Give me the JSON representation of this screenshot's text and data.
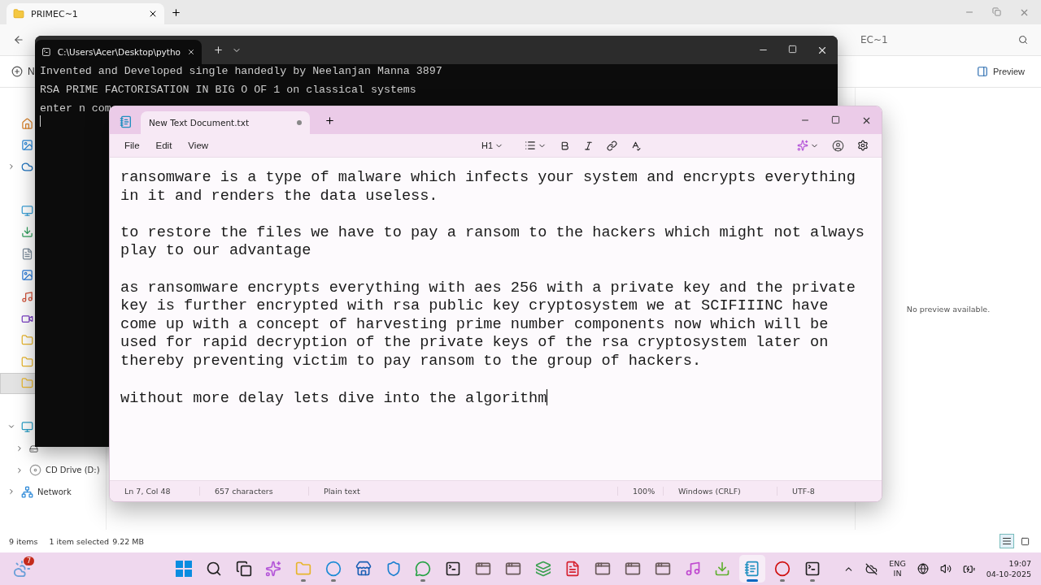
{
  "explorer": {
    "tab_title": "PRIMEC~1",
    "address_fragment": "EC~1",
    "new_button": "N",
    "preview_button": "Preview",
    "sidebar": [
      {
        "kind": "home"
      },
      {
        "kind": "gallery"
      },
      {
        "kind": "cloud",
        "expanded": false
      },
      {
        "kind": "desktop"
      },
      {
        "kind": "downloads"
      },
      {
        "kind": "documents"
      },
      {
        "kind": "pictures"
      },
      {
        "kind": "music"
      },
      {
        "kind": "videos"
      },
      {
        "kind": "folder"
      },
      {
        "kind": "folder"
      },
      {
        "kind": "folder",
        "selected": true
      },
      {
        "kind": "pc",
        "expanded": true,
        "children": [
          {
            "kind": "drive",
            "expanded": false
          },
          {
            "kind": "cd",
            "label": "CD Drive (D:)",
            "expanded": false
          }
        ]
      },
      {
        "kind": "network",
        "label": "Network",
        "expanded": false
      }
    ],
    "no_preview": "No preview available.",
    "status": {
      "items": "9 items",
      "selected": "1 item selected",
      "size": "9.22 MB"
    },
    "views": [
      {
        "kind": "details",
        "selected": true
      },
      {
        "kind": "tiles",
        "selected": false
      }
    ]
  },
  "terminal": {
    "tab_title": "C:\\Users\\Acer\\Desktop\\pytho",
    "lines": [
      "Invented and Developed single handedly by Neelanjan Manna 3897",
      "RSA PRIME FACTORISATION IN BIG O OF 1 on classical systems",
      "enter n com"
    ]
  },
  "notepad": {
    "tab_title": "New Text Document.txt",
    "unsaved": true,
    "menu": [
      "File",
      "Edit",
      "View"
    ],
    "heading": "H1",
    "paragraphs": [
      "ransomware is a type of malware which infects your system and encrypts everything in it and renders the data useless.",
      "to restore the files we have to pay a ransom to the hackers which might not always play to our advantage",
      "as ransomware encrypts everything with aes 256 with a private key and the private key is further encrypted with rsa public key cryptosystem we at SCIFIIINC have come up with a concept of harvesting prime number components now which will be used for rapid decryption of the private keys of the rsa cryptosystem later on thereby preventing victim to pay ransom to the group of hackers.",
      "without more delay lets dive into the algorithm"
    ],
    "status": {
      "position": "Ln 7, Col 48",
      "characters": "657 characters",
      "format": "Plain text",
      "zoom": "100%",
      "line_ending": "Windows (CRLF)",
      "encoding": "UTF-8"
    }
  },
  "taskbar": {
    "weather_badge": "7",
    "apps": [
      {
        "kind": "start",
        "running": false,
        "selected": false
      },
      {
        "kind": "search",
        "running": false,
        "selected": false
      },
      {
        "kind": "taskview",
        "running": false,
        "selected": false
      },
      {
        "kind": "copilot",
        "running": false,
        "selected": false
      },
      {
        "kind": "folder",
        "running": true,
        "selected": false
      },
      {
        "kind": "browser",
        "running": true,
        "selected": false
      },
      {
        "kind": "store",
        "running": false,
        "selected": false
      },
      {
        "kind": "shield",
        "running": false,
        "selected": false
      },
      {
        "kind": "chat",
        "running": true,
        "selected": false
      },
      {
        "kind": "console",
        "running": false,
        "selected": false
      },
      {
        "kind": "app",
        "running": false,
        "selected": false
      },
      {
        "kind": "app",
        "running": false,
        "selected": false
      },
      {
        "kind": "layers",
        "running": false,
        "selected": false
      },
      {
        "kind": "office",
        "running": false,
        "selected": false
      },
      {
        "kind": "app",
        "running": false,
        "selected": false
      },
      {
        "kind": "app",
        "running": false,
        "selected": false
      },
      {
        "kind": "app",
        "running": false,
        "selected": false
      },
      {
        "kind": "music",
        "running": false,
        "selected": false
      },
      {
        "kind": "torrent",
        "running": false,
        "selected": false
      },
      {
        "kind": "notepad",
        "running": true,
        "selected": true
      },
      {
        "kind": "record",
        "running": true,
        "selected": false
      },
      {
        "kind": "console",
        "running": true,
        "selected": false
      }
    ],
    "language": "ENG",
    "region": "IN",
    "time": "19:07",
    "date": "04-10-2025"
  }
}
